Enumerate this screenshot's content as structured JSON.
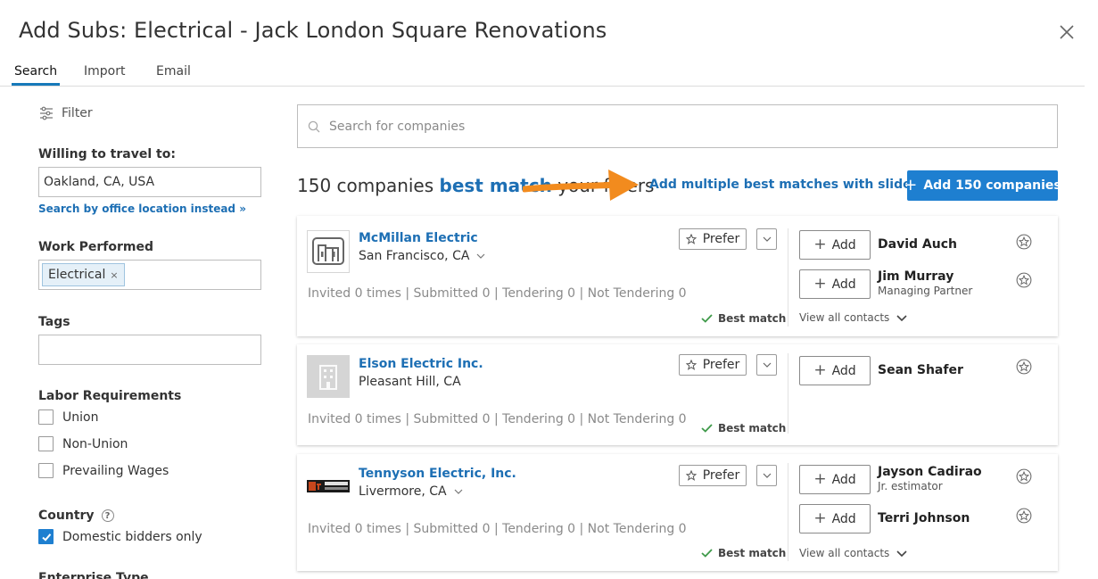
{
  "modal": {
    "title": "Add Subs: Electrical - Jack London Square Renovations"
  },
  "tabs": [
    {
      "label": "Search",
      "active": true
    },
    {
      "label": "Import",
      "active": false
    },
    {
      "label": "Email",
      "active": false
    }
  ],
  "filters": {
    "heading": "Filter",
    "travel": {
      "label": "Willing to travel to:",
      "value": "Oakland, CA, USA",
      "link": "Search by office location instead »"
    },
    "work": {
      "label": "Work Performed",
      "chips": [
        "Electrical"
      ]
    },
    "tags": {
      "label": "Tags",
      "value": ""
    },
    "labor": {
      "label": "Labor Requirements",
      "options": [
        {
          "label": "Union",
          "checked": false
        },
        {
          "label": "Non-Union",
          "checked": false
        },
        {
          "label": "Prevailing Wages",
          "checked": false
        }
      ]
    },
    "country": {
      "label": "Country",
      "option": {
        "label": "Domestic bidders only",
        "checked": true
      }
    },
    "enterprise_label": "Enterprise Type"
  },
  "search": {
    "placeholder": "Search for companies",
    "value": ""
  },
  "results": {
    "count_prefix": "150 companies",
    "count_highlight": "best match",
    "count_suffix": "your filters",
    "slider_link": "Add multiple best matches with slider »",
    "add_all_label": "Add 150 companies"
  },
  "companies": [
    {
      "name": "McMillan Electric",
      "location": "San Francisco, CA",
      "logo": "mcmillan-logo",
      "prefer_label": "Prefer",
      "stats": "Invited 0 times | Submitted 0 | Tendering 0 | Not Tendering 0",
      "best_match": "Best match",
      "add_label": "Add",
      "contacts": [
        {
          "name": "David Auch",
          "role": ""
        },
        {
          "name": "Jim Murray",
          "role": "Managing Partner"
        }
      ],
      "view_all": "View all contacts"
    },
    {
      "name": "Elson Electric Inc.",
      "location": "Pleasant Hill, CA",
      "logo": "building-placeholder-logo",
      "prefer_label": "Prefer",
      "stats": "Invited 0 times | Submitted 0 | Tendering 0 | Not Tendering 0",
      "best_match": "Best match",
      "add_label": "Add",
      "contacts": [
        {
          "name": "Sean Shafer",
          "role": ""
        }
      ]
    },
    {
      "name": "Tennyson Electric, Inc.",
      "location": "Livermore, CA",
      "logo": "tennyson-logo",
      "prefer_label": "Prefer",
      "stats": "Invited 0 times | Submitted 0 | Tendering 0 | Not Tendering 0",
      "best_match": "Best match",
      "add_label": "Add",
      "contacts": [
        {
          "name": "Jayson Cadirao",
          "role": "Jr. estimator"
        },
        {
          "name": "Terri Johnson",
          "role": ""
        }
      ],
      "view_all": "View all contacts"
    }
  ],
  "colors": {
    "link": "#1d6fb4",
    "primary": "#1e7fd0",
    "annotation_arrow": "#f28b1e"
  }
}
